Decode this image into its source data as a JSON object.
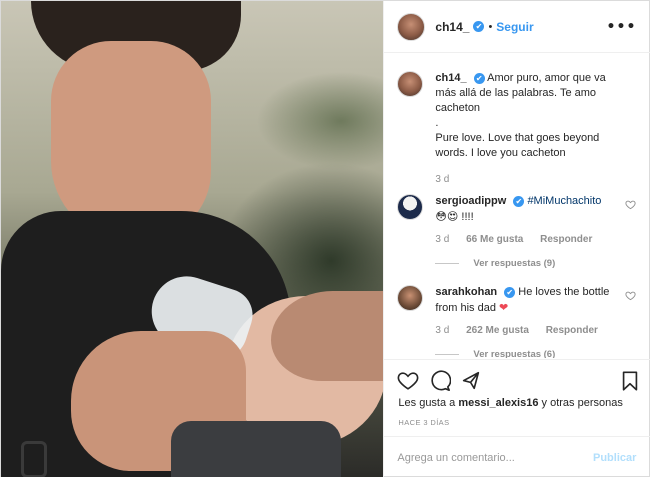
{
  "post": {
    "photo_alt": "photo",
    "header": {
      "username": "ch14_",
      "verified_badge": "✔",
      "separator": "•",
      "follow_label": "Seguir",
      "more_icon": "more-icon",
      "more_glyph": "•••"
    },
    "caption": {
      "username": "ch14_",
      "text_es": "Amor puro, amor que va más allá de las palabras. Te amo cacheton",
      "dot": ".",
      "text_en": "Pure love. Love that goes beyond words. I love you cacheton",
      "time": "3 d"
    },
    "comments": [
      {
        "username": "sergioadippw",
        "hashtag": "#MiMuchachito",
        "emojis": "😳😍",
        "trailing": " !!!!",
        "time": "3 d",
        "likes": "66 Me gusta",
        "reply_label": "Responder",
        "replies_label": "Ver respuestas (9)"
      },
      {
        "username": "sarahkohan",
        "text": "He loves the bottle from his dad",
        "heart": "❤",
        "time": "3 d",
        "likes": "262 Me gusta",
        "reply_label": "Responder",
        "replies_label": "Ver respuestas (6)"
      }
    ],
    "actions": {
      "likes_text_prefix": "Les gusta a ",
      "likes_user": "messi_alexis16",
      "likes_text_suffix": " y otras personas",
      "timestamp": "HACE 3 DÍAS"
    },
    "comment_box": {
      "placeholder": "Agrega un comentario...",
      "publish_label": "Publicar"
    },
    "colors": {
      "accent": "#3897f0",
      "muted": "#8e8e8e",
      "publish_disabled": "#b2dffc",
      "heart": "#ed4956"
    }
  }
}
